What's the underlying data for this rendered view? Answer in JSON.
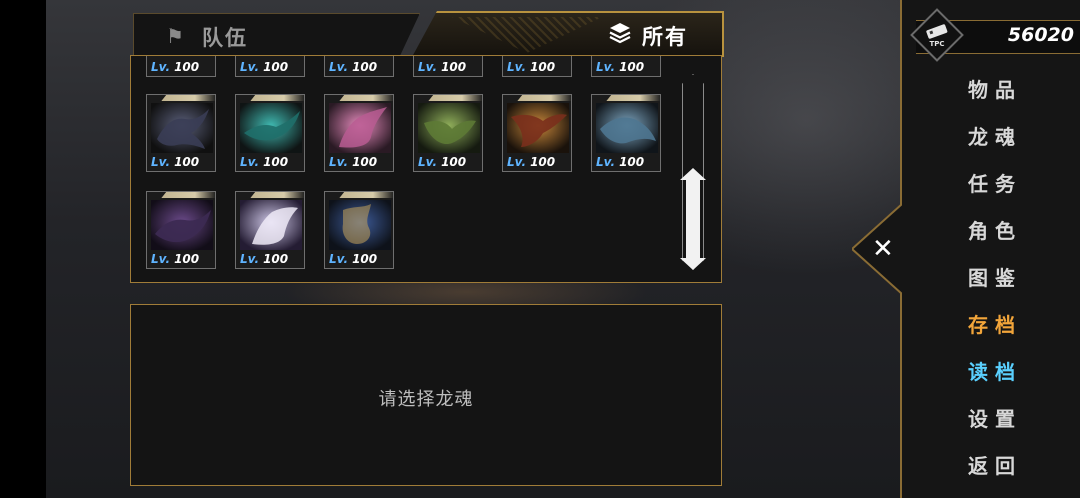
{
  "tabs": {
    "team_label": "队伍",
    "all_label": "所有"
  },
  "grid": {
    "top_row": [
      {
        "lv_prefix": "Lv.",
        "level": "100"
      },
      {
        "lv_prefix": "Lv.",
        "level": "100"
      },
      {
        "lv_prefix": "Lv.",
        "level": "100"
      },
      {
        "lv_prefix": "Lv.",
        "level": "100"
      },
      {
        "lv_prefix": "Lv.",
        "level": "100"
      },
      {
        "lv_prefix": "Lv.",
        "level": "100"
      }
    ],
    "row2": [
      {
        "lv_prefix": "Lv.",
        "level": "100",
        "color": "#5a5f7a"
      },
      {
        "lv_prefix": "Lv.",
        "level": "100",
        "color": "#3fb8b0"
      },
      {
        "lv_prefix": "Lv.",
        "level": "100",
        "color": "#e68bbd"
      },
      {
        "lv_prefix": "Lv.",
        "level": "100",
        "color": "#8fae5a"
      },
      {
        "lv_prefix": "Lv.",
        "level": "100",
        "color": "#c8873a"
      },
      {
        "lv_prefix": "Lv.",
        "level": "100",
        "color": "#7ea7c2"
      }
    ],
    "row3": [
      {
        "lv_prefix": "Lv.",
        "level": "100",
        "color": "#6b4a8a"
      },
      {
        "lv_prefix": "Lv.",
        "level": "100",
        "color": "#cfc8e8"
      },
      {
        "lv_prefix": "Lv.",
        "level": "100",
        "color": "#3e5c9a"
      }
    ]
  },
  "detail": {
    "hint": "请选择龙魂"
  },
  "currency": {
    "icon_label": "TPC",
    "value": "56020"
  },
  "menu": [
    {
      "label": "物品",
      "state": "normal"
    },
    {
      "label": "龙魂",
      "state": "normal"
    },
    {
      "label": "任务",
      "state": "normal"
    },
    {
      "label": "角色",
      "state": "normal"
    },
    {
      "label": "图鉴",
      "state": "normal"
    },
    {
      "label": "存档",
      "state": "save"
    },
    {
      "label": "读档",
      "state": "load"
    },
    {
      "label": "设置",
      "state": "normal"
    },
    {
      "label": "返回",
      "state": "normal"
    }
  ],
  "colors": {
    "accent_gold": "#b8923e",
    "lv_blue": "#5fb4ff",
    "save_orange": "#f2a53a",
    "load_cyan": "#5ad0ff"
  }
}
